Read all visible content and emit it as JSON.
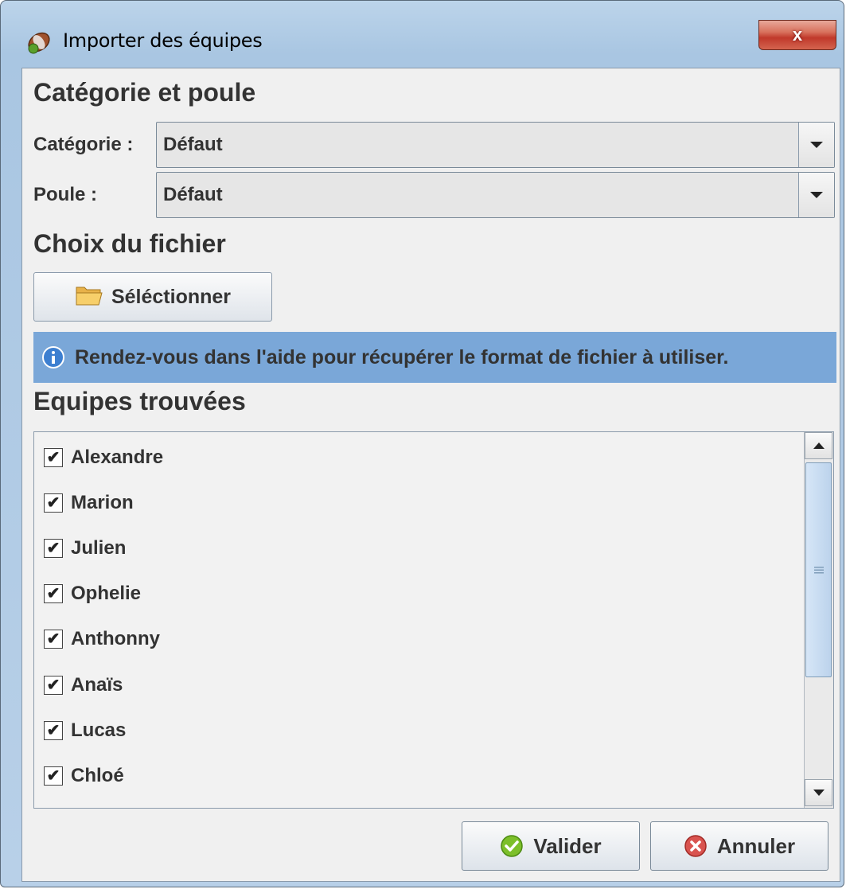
{
  "window": {
    "title": "Importer des équipes",
    "close_label": "x"
  },
  "section_category": {
    "title": "Catégorie et poule",
    "category_label": "Catégorie :",
    "category_value": "Défaut",
    "pool_label": "Poule :",
    "pool_value": "Défaut"
  },
  "section_file": {
    "title": "Choix du fichier",
    "select_button_label": "Séléctionner",
    "info_text": "Rendez-vous dans l'aide pour récupérer le format de fichier à utiliser."
  },
  "section_teams": {
    "title": "Equipes trouvées",
    "teams": [
      {
        "name": "Alexandre",
        "checked": true
      },
      {
        "name": "Marion",
        "checked": true
      },
      {
        "name": "Julien",
        "checked": true
      },
      {
        "name": "Ophelie",
        "checked": true
      },
      {
        "name": "Anthonny",
        "checked": true
      },
      {
        "name": "Anaïs",
        "checked": true
      },
      {
        "name": "Lucas",
        "checked": true
      },
      {
        "name": "Chloé",
        "checked": true
      }
    ]
  },
  "actions": {
    "validate_label": "Valider",
    "cancel_label": "Annuler"
  },
  "icons": {
    "app": "rugby-ball-icon",
    "folder": "folder-open-icon",
    "info": "info-icon",
    "validate": "check-circle-icon",
    "cancel": "x-circle-icon"
  },
  "colors": {
    "info_banner": "#7aa7d8",
    "validate_icon": "#7cbf2a",
    "cancel_icon": "#d9534f"
  }
}
